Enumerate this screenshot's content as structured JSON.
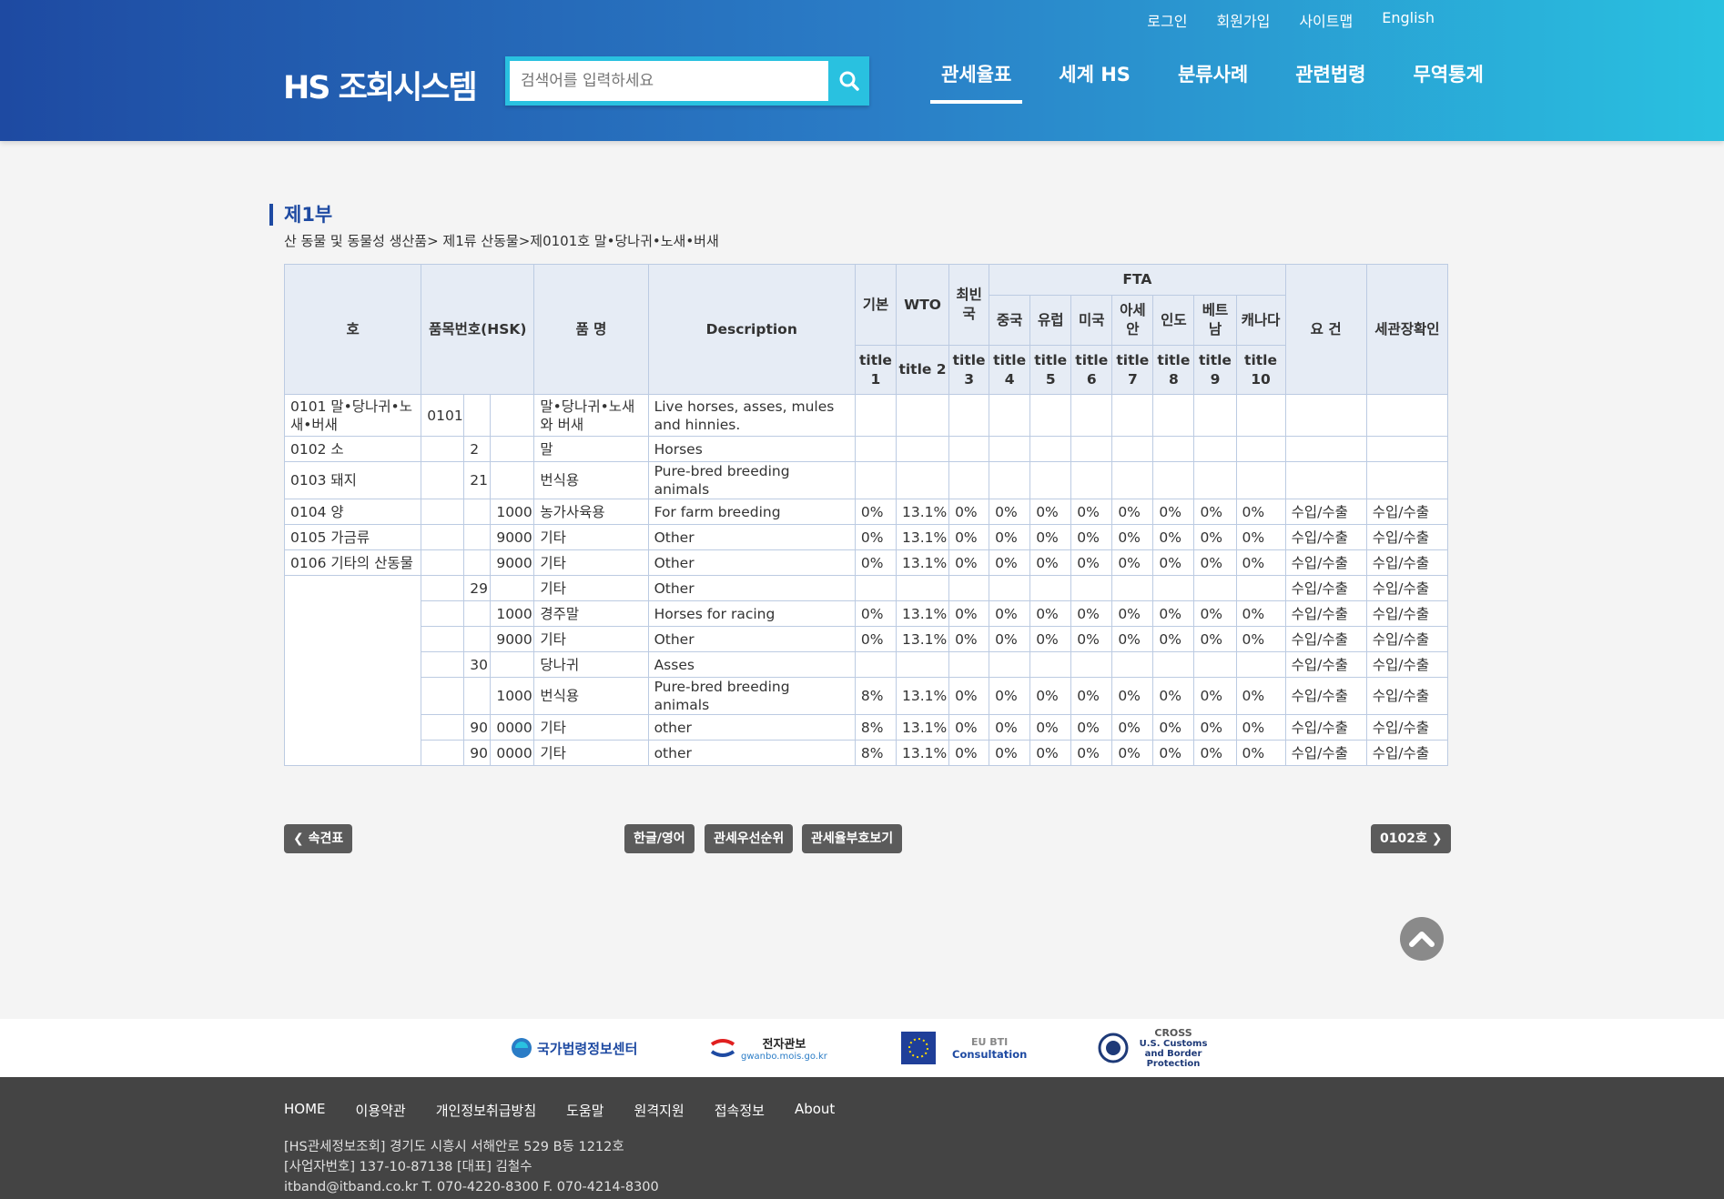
{
  "util": {
    "login": "로그인",
    "join": "회원가입",
    "sitemap": "사이트맵",
    "english": "English"
  },
  "logo": "HS 조회시스템",
  "search": {
    "placeholder": "검색어를 입력하세요"
  },
  "nav": [
    "관세율표",
    "세계 HS",
    "분류사례",
    "관련법령",
    "무역통계"
  ],
  "section": {
    "title": "제1부",
    "breadcrumb": "산 동물 및 동물성 생산품> 제1류 산동물>제0101호 말•당나귀•노새•버새"
  },
  "table": {
    "headers": {
      "ho": "호",
      "hsk": "품목번호(HSK)",
      "name": "품 명",
      "desc": "Description",
      "basic": "기본",
      "wto": "WTO",
      "ldc": "최빈국",
      "fta": "FTA",
      "req": "요 건",
      "customs": "세관장확인"
    },
    "fta_countries": [
      "중국",
      "유럽",
      "미국",
      "아세안",
      "인도",
      "베트남",
      "캐나다"
    ],
    "subtitles": [
      "title 1",
      "title 2",
      "title 3",
      "title 4",
      "title 5",
      "title 6",
      "title 7",
      "title 8",
      "title 9",
      "title 10"
    ],
    "rows": [
      {
        "ho": "0101 말•당나귀•노새•버새",
        "c1": "0101",
        "c2": "",
        "c3": "",
        "name": "말•당나귀•노새와 버새",
        "desc": "Live horses, asses, mules and hinnies.",
        "rates": [
          "",
          "",
          "",
          "",
          "",
          "",
          "",
          "",
          "",
          ""
        ],
        "req": "",
        "customs": ""
      },
      {
        "ho": "0102 소",
        "c1": "",
        "c2": "2",
        "c3": "",
        "name": "말",
        "desc": "Horses",
        "rates": [
          "",
          "",
          "",
          "",
          "",
          "",
          "",
          "",
          "",
          ""
        ],
        "req": "",
        "customs": ""
      },
      {
        "ho": "0103 돼지",
        "c1": "",
        "c2": "21",
        "c3": "",
        "name": "번식용",
        "desc": "Pure-bred breeding animals",
        "rates": [
          "",
          "",
          "",
          "",
          "",
          "",
          "",
          "",
          "",
          ""
        ],
        "req": "",
        "customs": ""
      },
      {
        "ho": "0104 양",
        "c1": "",
        "c2": "",
        "c3": "1000",
        "name": "농가사육용",
        "desc": "For farm breeding",
        "rates": [
          "0%",
          "13.1%",
          "0%",
          "0%",
          "0%",
          "0%",
          "0%",
          "0%",
          "0%",
          "0%"
        ],
        "req": "수입/수출",
        "customs": "수입/수출"
      },
      {
        "ho": "0105 가금류",
        "c1": "",
        "c2": "",
        "c3": "9000",
        "name": "기타",
        "desc": "Other",
        "rates": [
          "0%",
          "13.1%",
          "0%",
          "0%",
          "0%",
          "0%",
          "0%",
          "0%",
          "0%",
          "0%"
        ],
        "req": "수입/수출",
        "customs": "수입/수출"
      },
      {
        "ho": "0106 기타의 산동물",
        "c1": "",
        "c2": "",
        "c3": "9000",
        "name": "기타",
        "desc": "Other",
        "rates": [
          "0%",
          "13.1%",
          "0%",
          "0%",
          "0%",
          "0%",
          "0%",
          "0%",
          "0%",
          "0%"
        ],
        "req": "수입/수출",
        "customs": "수입/수출"
      },
      {
        "ho": "",
        "c1": "",
        "c2": "29",
        "c3": "",
        "name": "기타",
        "desc": "Other",
        "rates": [
          "",
          "",
          "",
          "",
          "",
          "",
          "",
          "",
          "",
          ""
        ],
        "req": "수입/수출",
        "customs": "수입/수출"
      },
      {
        "ho": "",
        "c1": "",
        "c2": "",
        "c3": "1000",
        "name": "경주말",
        "desc": "Horses for racing",
        "rates": [
          "0%",
          "13.1%",
          "0%",
          "0%",
          "0%",
          "0%",
          "0%",
          "0%",
          "0%",
          "0%"
        ],
        "req": "수입/수출",
        "customs": "수입/수출"
      },
      {
        "ho": "",
        "c1": "",
        "c2": "",
        "c3": "9000",
        "name": "기타",
        "desc": "Other",
        "rates": [
          "0%",
          "13.1%",
          "0%",
          "0%",
          "0%",
          "0%",
          "0%",
          "0%",
          "0%",
          "0%"
        ],
        "req": "수입/수출",
        "customs": "수입/수출"
      },
      {
        "ho": "",
        "c1": "",
        "c2": "30",
        "c3": "",
        "name": "당나귀",
        "desc": "Asses",
        "rates": [
          "",
          "",
          "",
          "",
          "",
          "",
          "",
          "",
          "",
          ""
        ],
        "req": "수입/수출",
        "customs": "수입/수출"
      },
      {
        "ho": "",
        "c1": "",
        "c2": "",
        "c3": "1000",
        "name": "번식용",
        "desc": "Pure-bred breeding animals",
        "rates": [
          "8%",
          "13.1%",
          "0%",
          "0%",
          "0%",
          "0%",
          "0%",
          "0%",
          "0%",
          "0%"
        ],
        "req": "수입/수출",
        "customs": "수입/수출"
      },
      {
        "ho": "",
        "c1": "",
        "c2": "90",
        "c3": "0000",
        "name": "기타",
        "desc": "other",
        "rates": [
          "8%",
          "13.1%",
          "0%",
          "0%",
          "0%",
          "0%",
          "0%",
          "0%",
          "0%",
          "0%"
        ],
        "req": "수입/수출",
        "customs": "수입/수출"
      },
      {
        "ho": "",
        "c1": "",
        "c2": "90",
        "c3": "0000",
        "name": "기타",
        "desc": "other",
        "rates": [
          "8%",
          "13.1%",
          "0%",
          "0%",
          "0%",
          "0%",
          "0%",
          "0%",
          "0%",
          "0%"
        ],
        "req": "수입/수출",
        "customs": "수입/수출"
      }
    ]
  },
  "buttons": {
    "prev": "속견표",
    "lang": "한글/영어",
    "priority": "관세우선순위",
    "symbol": "관세율부호보기",
    "next": "0102호"
  },
  "partners": [
    {
      "name": "국가법령정보센터"
    },
    {
      "name": "전자관보",
      "sub": "gwanbo.mois.go.kr"
    },
    {
      "name": "EU BTI",
      "sub": "Consultation"
    },
    {
      "name": "CROSS",
      "sub": "U.S. Customs and Border Protection"
    }
  ],
  "footer": {
    "nav": [
      "HOME",
      "이용약관",
      "개인정보취급방침",
      "도움말",
      "원격지원",
      "접속정보",
      "About"
    ],
    "line1": "[HS관세정보조회]  경기도 시흥시 서해안로 529 B동 1212호",
    "line2": "[사업자번호]  137-10-87138  [대표]  김철수",
    "line3": "itband@itband.co.kr   T. 070-4220-8300    F. 070-4214-8300"
  },
  "colors": {
    "header_start": "#1e4aa2",
    "header_end": "#29c1e0",
    "accent": "#1e4aa2",
    "table_header": "#e6ecf5",
    "button": "#5b5b5b",
    "footer": "#444444"
  }
}
